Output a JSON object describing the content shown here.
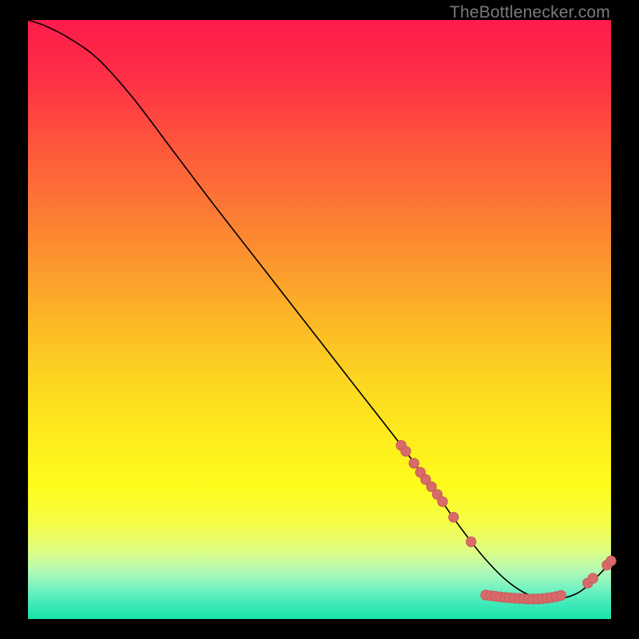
{
  "attribution": "TheBottlenecker.com",
  "colors": {
    "bg": "#000000",
    "attribution_text": "#7a7a7a",
    "curve": "#000000",
    "marker_fill": "#d86a6a",
    "marker_stroke": "#c65a5a",
    "gradient_stops": [
      {
        "offset": 0.0,
        "color": "#fe1b4b"
      },
      {
        "offset": 0.1,
        "color": "#fe3046"
      },
      {
        "offset": 0.22,
        "color": "#fd5a3b"
      },
      {
        "offset": 0.35,
        "color": "#fc8432"
      },
      {
        "offset": 0.48,
        "color": "#fcb028"
      },
      {
        "offset": 0.6,
        "color": "#fcd621"
      },
      {
        "offset": 0.7,
        "color": "#fded1c"
      },
      {
        "offset": 0.78,
        "color": "#fefc1d"
      },
      {
        "offset": 0.84,
        "color": "#f5fd46"
      },
      {
        "offset": 0.885,
        "color": "#e0fd82"
      },
      {
        "offset": 0.92,
        "color": "#b1f9b6"
      },
      {
        "offset": 0.95,
        "color": "#72f2c1"
      },
      {
        "offset": 0.975,
        "color": "#3fe9b8"
      },
      {
        "offset": 1.0,
        "color": "#19e2aa"
      }
    ]
  },
  "chart_data": {
    "type": "line",
    "title": "",
    "xlabel": "",
    "ylabel": "",
    "xlim": [
      0,
      100
    ],
    "ylim": [
      0,
      100
    ],
    "curve": {
      "x": [
        0,
        3,
        7,
        12,
        18,
        25,
        32,
        40,
        48,
        56,
        64,
        70,
        74,
        78,
        82,
        86,
        90,
        94,
        97,
        100
      ],
      "y": [
        100,
        99,
        97,
        93.5,
        87,
        78,
        69,
        59,
        49,
        39,
        29,
        21,
        15.5,
        10.5,
        6.5,
        4,
        3.3,
        4.2,
        6.5,
        9.5
      ]
    },
    "markers": [
      {
        "x": 64.0,
        "y": 29.0
      },
      {
        "x": 64.8,
        "y": 28.0
      },
      {
        "x": 66.2,
        "y": 26.0
      },
      {
        "x": 67.3,
        "y": 24.5
      },
      {
        "x": 68.2,
        "y": 23.3
      },
      {
        "x": 69.2,
        "y": 22.1
      },
      {
        "x": 70.2,
        "y": 20.8
      },
      {
        "x": 71.1,
        "y": 19.6
      },
      {
        "x": 73.0,
        "y": 17.0
      },
      {
        "x": 76.0,
        "y": 12.9
      },
      {
        "x": 78.5,
        "y": 4.0
      },
      {
        "x": 79.4,
        "y": 3.9
      },
      {
        "x": 80.2,
        "y": 3.8
      },
      {
        "x": 81.0,
        "y": 3.7
      },
      {
        "x": 81.8,
        "y": 3.6
      },
      {
        "x": 82.6,
        "y": 3.55
      },
      {
        "x": 83.4,
        "y": 3.5
      },
      {
        "x": 84.2,
        "y": 3.45
      },
      {
        "x": 85.0,
        "y": 3.4
      },
      {
        "x": 85.8,
        "y": 3.35
      },
      {
        "x": 86.6,
        "y": 3.35
      },
      {
        "x": 87.4,
        "y": 3.35
      },
      {
        "x": 88.2,
        "y": 3.4
      },
      {
        "x": 89.0,
        "y": 3.5
      },
      {
        "x": 89.8,
        "y": 3.6
      },
      {
        "x": 90.6,
        "y": 3.75
      },
      {
        "x": 91.4,
        "y": 3.95
      },
      {
        "x": 96.0,
        "y": 6.0
      },
      {
        "x": 96.9,
        "y": 6.8
      },
      {
        "x": 99.3,
        "y": 9.0
      },
      {
        "x": 100.0,
        "y": 9.7
      }
    ]
  }
}
